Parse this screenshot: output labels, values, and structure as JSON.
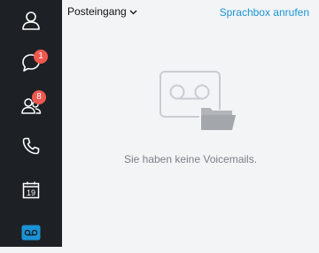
{
  "sidebar": {
    "items": [
      {
        "name": "profile",
        "icon": "person-icon"
      },
      {
        "name": "chats",
        "icon": "chat-bubble-icon",
        "badge": "1"
      },
      {
        "name": "contacts",
        "icon": "contacts-icon",
        "badge": "8"
      },
      {
        "name": "calls",
        "icon": "phone-icon"
      },
      {
        "name": "calendar",
        "icon": "calendar-icon",
        "day": "19"
      },
      {
        "name": "voicemail",
        "icon": "voicemail-icon",
        "active": true
      }
    ],
    "badge_color": "#f0584f",
    "active_color": "#1a93d6"
  },
  "header": {
    "folder": "Posteingang",
    "action_link": "Sprachbox anrufen"
  },
  "empty_state": {
    "icon": "voicemail-folder-icon",
    "message": "Sie haben keine Voicemails."
  },
  "colors": {
    "sidebar_bg": "#1d2125",
    "content_bg": "#f3f4f6",
    "link": "#1a93d6"
  }
}
